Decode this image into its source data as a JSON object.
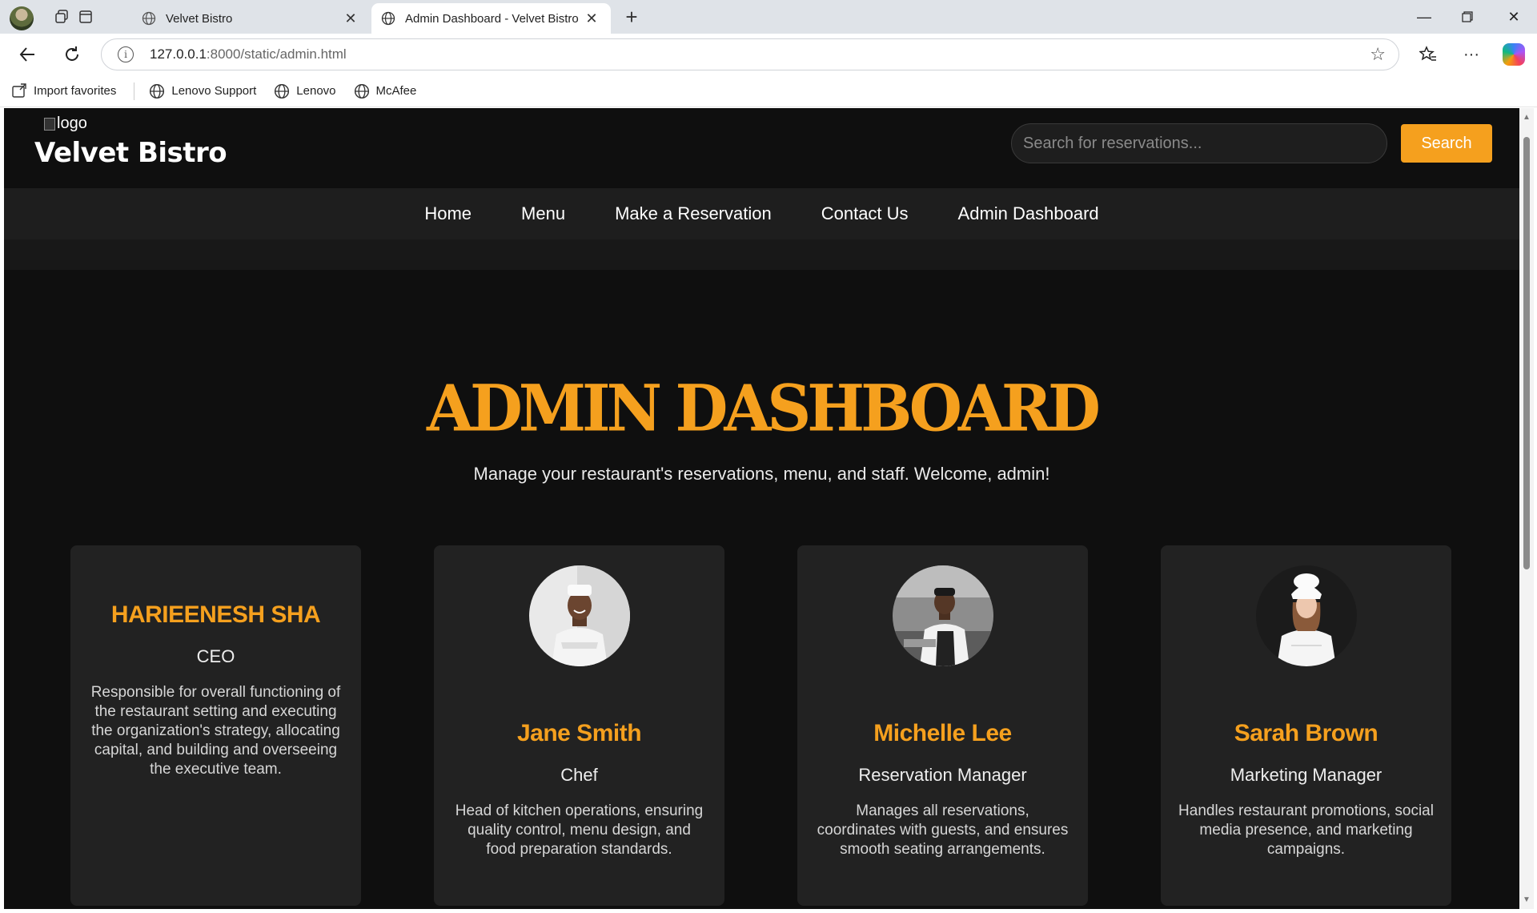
{
  "browser": {
    "tabs": [
      {
        "title": "Velvet Bistro",
        "active": false
      },
      {
        "title": "Admin Dashboard - Velvet Bistro",
        "active": true
      }
    ],
    "url_host": "127.0.0.1",
    "url_path": ":8000/static/admin.html",
    "bookmarks": [
      {
        "label": "Import favorites",
        "icon": "import-icon"
      },
      {
        "label": "Lenovo Support",
        "icon": "globe-icon"
      },
      {
        "label": "Lenovo",
        "icon": "globe-icon"
      },
      {
        "label": "McAfee",
        "icon": "globe-icon"
      }
    ]
  },
  "header": {
    "logo_alt": "logo",
    "brand": "Velvet Bistro",
    "search_placeholder": "Search for reservations...",
    "search_button": "Search"
  },
  "nav": {
    "items": [
      "Home",
      "Menu",
      "Make a Reservation",
      "Contact Us",
      "Admin Dashboard"
    ]
  },
  "hero": {
    "title": "ADMIN DASHBOARD",
    "subtitle": "Manage your restaurant's reservations, menu, and staff. Welcome, admin!"
  },
  "staff": [
    {
      "name": "HARIEENESH SHA",
      "role": "CEO",
      "description": "Responsible for overall functioning of the restaurant setting and executing the organization's strategy, allocating capital, and building and overseeing the executive team."
    },
    {
      "name": "Jane Smith",
      "role": "Chef",
      "description": "Head of kitchen operations, ensuring quality control, menu design, and food preparation standards."
    },
    {
      "name": "Michelle Lee",
      "role": "Reservation Manager",
      "description": "Manages all reservations, coordinates with guests, and ensures smooth seating arrangements."
    },
    {
      "name": "Sarah Brown",
      "role": "Marketing Manager",
      "description": "Handles restaurant promotions, social media presence, and marketing campaigns."
    }
  ],
  "colors": {
    "accent": "#f5a01e",
    "page_bg": "#0f0f0f",
    "nav_bg": "#1e1e1e",
    "card_bg": "#222222"
  }
}
